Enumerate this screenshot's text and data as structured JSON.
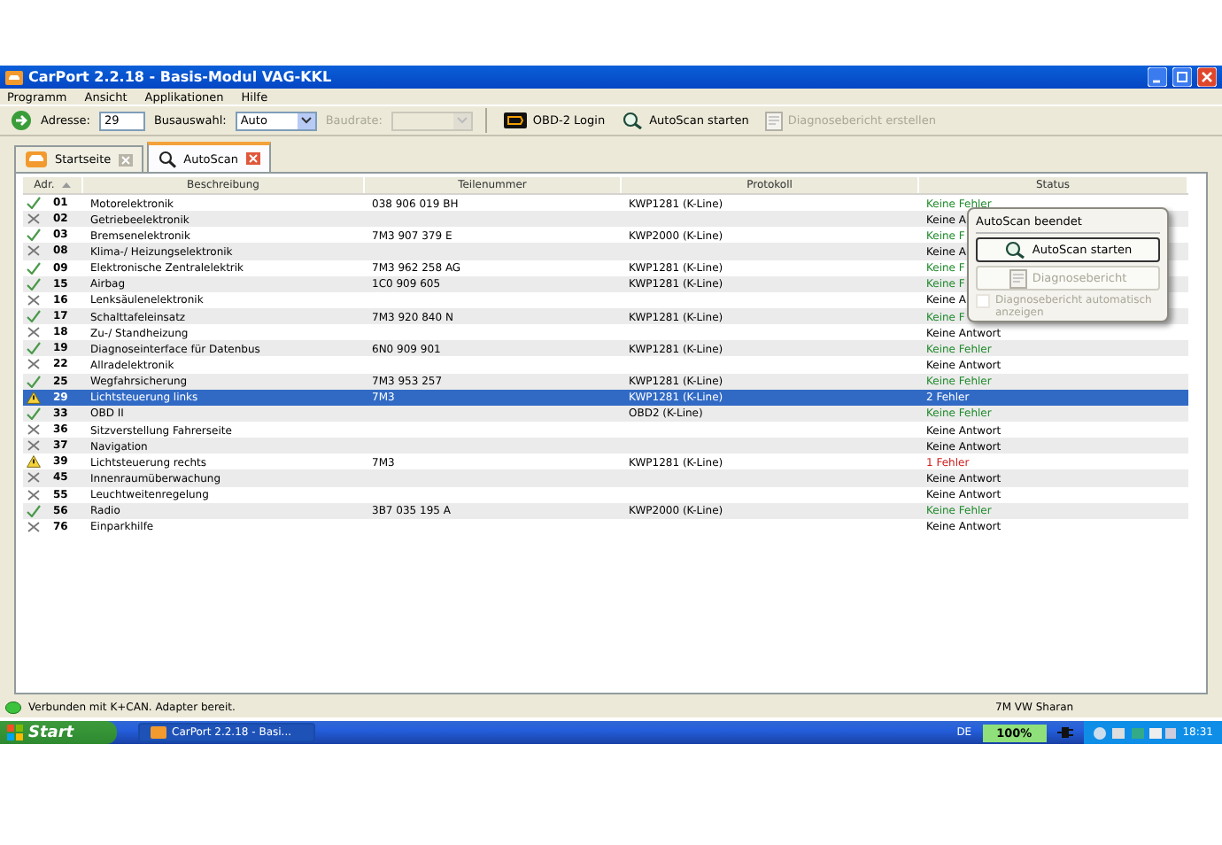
{
  "window": {
    "title": "CarPort 2.2.18  - Basis-Modul VAG-KKL"
  },
  "menu": [
    "Programm",
    "Ansicht",
    "Applikationen",
    "Hilfe"
  ],
  "toolbar": {
    "address_label": "Adresse:",
    "address_value": "29",
    "bus_label": "Busauswahl:",
    "bus_value": "Auto",
    "baud_label": "Baudrate:",
    "baud_disabled": true,
    "buttons": [
      {
        "kind": "obd",
        "label": "OBD-2 Login",
        "disabled": false
      },
      {
        "kind": "scan",
        "label": "AutoScan starten",
        "disabled": false
      },
      {
        "kind": "report",
        "label": "Diagnosebericht erstellen",
        "disabled": true
      }
    ]
  },
  "tabs": [
    {
      "label": "Startseite",
      "selected": false,
      "kind": "car"
    },
    {
      "label": "AutoScan",
      "selected": true,
      "kind": "search"
    }
  ],
  "table": {
    "columns": [
      "Adr.",
      "Beschreibung",
      "Teilenummer",
      "Protokoll",
      "Status"
    ],
    "rows": [
      {
        "kind": "ok",
        "selected": false,
        "addr": "01",
        "desc": "Motorelektronik",
        "part": "038 906 019 BH",
        "protocol": "KWP1281 (K-Line)",
        "status": "Keine Fehler"
      },
      {
        "kind": "none",
        "selected": false,
        "addr": "02",
        "desc": "Getriebeelektronik",
        "part": "",
        "protocol": "",
        "status": "Keine A"
      },
      {
        "kind": "ok",
        "selected": false,
        "addr": "03",
        "desc": "Bremsenelektronik",
        "part": "7M3 907 379 E",
        "protocol": "KWP2000 (K-Line)",
        "status": "Keine F"
      },
      {
        "kind": "none",
        "selected": false,
        "addr": "08",
        "desc": "Klima-/ Heizungselektronik",
        "part": "",
        "protocol": "",
        "status": "Keine A"
      },
      {
        "kind": "ok",
        "selected": false,
        "addr": "09",
        "desc": "Elektronische Zentralelektrik",
        "part": "7M3 962 258 AG",
        "protocol": "KWP1281 (K-Line)",
        "status": "Keine F"
      },
      {
        "kind": "ok",
        "selected": false,
        "addr": "15",
        "desc": "Airbag",
        "part": "1C0 909 605",
        "protocol": "KWP1281 (K-Line)",
        "status": "Keine F"
      },
      {
        "kind": "none",
        "selected": false,
        "addr": "16",
        "desc": "Lenksäulenelektronik",
        "part": "",
        "protocol": "",
        "status": "Keine A"
      },
      {
        "kind": "ok",
        "selected": false,
        "addr": "17",
        "desc": "Schalttafeleinsatz",
        "part": "7M3 920 840 N",
        "protocol": "KWP1281 (K-Line)",
        "status": "Keine F"
      },
      {
        "kind": "none",
        "selected": false,
        "addr": "18",
        "desc": "Zu-/ Standheizung",
        "part": "",
        "protocol": "",
        "status": "Keine Antwort"
      },
      {
        "kind": "ok",
        "selected": false,
        "addr": "19",
        "desc": "Diagnoseinterface für Datenbus",
        "part": "6N0 909 901",
        "protocol": "KWP1281 (K-Line)",
        "status": "Keine Fehler"
      },
      {
        "kind": "none",
        "selected": false,
        "addr": "22",
        "desc": "Allradelektronik",
        "part": "",
        "protocol": "",
        "status": "Keine Antwort"
      },
      {
        "kind": "ok",
        "selected": false,
        "addr": "25",
        "desc": "Wegfahrsicherung",
        "part": "7M3 953 257",
        "protocol": "KWP1281 (K-Line)",
        "status": "Keine Fehler"
      },
      {
        "kind": "warning",
        "selected": true,
        "addr": "29",
        "desc": "Lichtsteuerung links",
        "part": "7M3",
        "protocol": "KWP1281 (K-Line)",
        "status": "2 Fehler"
      },
      {
        "kind": "ok",
        "selected": false,
        "addr": "33",
        "desc": "OBD II",
        "part": "",
        "protocol": "OBD2 (K-Line)",
        "status": "Keine Fehler"
      },
      {
        "kind": "none",
        "selected": false,
        "addr": "36",
        "desc": "Sitzverstellung Fahrerseite",
        "part": "",
        "protocol": "",
        "status": "Keine Antwort"
      },
      {
        "kind": "none",
        "selected": false,
        "addr": "37",
        "desc": "Navigation",
        "part": "",
        "protocol": "",
        "status": "Keine Antwort"
      },
      {
        "kind": "warning",
        "selected": false,
        "addr": "39",
        "desc": "Lichtsteuerung rechts",
        "part": "7M3",
        "protocol": "KWP1281 (K-Line)",
        "status": "1 Fehler"
      },
      {
        "kind": "none",
        "selected": false,
        "addr": "45",
        "desc": "Innenraumüberwachung",
        "part": "",
        "protocol": "",
        "status": "Keine Antwort"
      },
      {
        "kind": "none",
        "selected": false,
        "addr": "55",
        "desc": "Leuchtweitenregelung",
        "part": "",
        "protocol": "",
        "status": "Keine Antwort"
      },
      {
        "kind": "ok",
        "selected": false,
        "addr": "56",
        "desc": "Radio",
        "part": "3B7 035 195 A",
        "protocol": "KWP2000 (K-Line)",
        "status": "Keine Fehler"
      },
      {
        "kind": "none",
        "selected": false,
        "addr": "76",
        "desc": "Einparkhilfe",
        "part": "",
        "protocol": "",
        "status": "Keine Antwort"
      }
    ]
  },
  "popup": {
    "title": "AutoScan beendet",
    "start_button": "AutoScan starten",
    "report_button": "Diagnosebericht",
    "report_disabled": true,
    "auto_label": "Diagnosebericht automatisch anzeigen",
    "auto_checked": false,
    "auto_disabled": true
  },
  "status_bar": {
    "message": "Verbunden mit K+CAN. Adapter bereit.",
    "vehicle": "7M VW Sharan"
  },
  "taskbar": {
    "start": "Start",
    "task": "CarPort 2.2.18 - Basi...",
    "language": "DE",
    "battery": "100%",
    "time": "18:31"
  }
}
